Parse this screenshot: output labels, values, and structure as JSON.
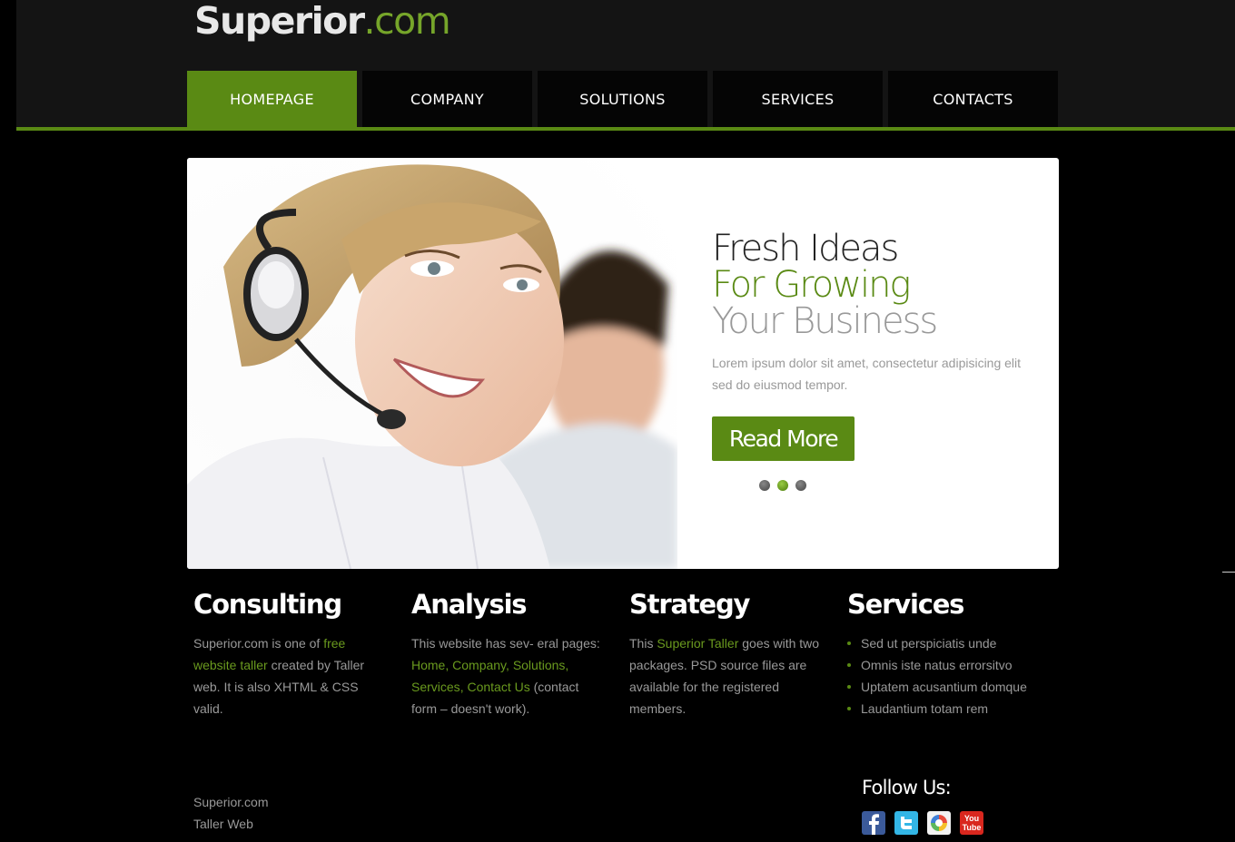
{
  "header": {
    "logo_main": "Superior",
    "logo_suffix": ".com"
  },
  "nav": {
    "items": [
      {
        "label": "HOMEPAGE",
        "active": true
      },
      {
        "label": "COMPANY",
        "active": false
      },
      {
        "label": "SOLUTIONS",
        "active": false
      },
      {
        "label": "SERVICES",
        "active": false
      },
      {
        "label": "CONTACTS",
        "active": false
      }
    ]
  },
  "slider": {
    "title_line1": "Fresh Ideas",
    "title_line2": "For Growing",
    "title_line3": "Your Business",
    "text": "Lorem ipsum dolor sit amet, consectetur adipisicing elit sed do eiusmod tempor.",
    "button_label": "Read More",
    "dots": 3,
    "active_dot": 2
  },
  "columns": {
    "consulting": {
      "title": "Consulting",
      "t1": "Superior.com is one of ",
      "l1": "free website taller",
      "t2": " created by Taller web. It is also XHTML & CSS valid."
    },
    "analysis": {
      "title": "Analysis",
      "t1": "This website has sev- eral pages: ",
      "l1": "Home",
      "s1": ", ",
      "l2": "Company",
      "s2": ", ",
      "l3": "Solutions",
      "s3": ", ",
      "l4": "Services",
      "s4": ", ",
      "l5": "Contact Us",
      "t2": " (contact form – doesn't work)."
    },
    "strategy": {
      "title": "Strategy",
      "t1": "This ",
      "l1": "Superior Taller",
      "t2": " goes with two packages. PSD source files are available for the registered members."
    },
    "services": {
      "title": "Services",
      "items": [
        "Sed ut perspiciatis unde",
        "Omnis iste natus errorsitvo",
        "Uptatem acusantium domque",
        "Laudantium totam rem"
      ]
    }
  },
  "footer": {
    "line1": "Superior.com",
    "line2": "Taller Web",
    "follow_label": "Follow Us:",
    "social": [
      "facebook-icon",
      "twitter-icon",
      "picasa-icon",
      "youtube-icon"
    ],
    "youtube_text_1": "You",
    "youtube_text_2": "Tube"
  },
  "colors": {
    "accent": "#5a8a14",
    "background": "#000000",
    "header_band": "#141414"
  }
}
